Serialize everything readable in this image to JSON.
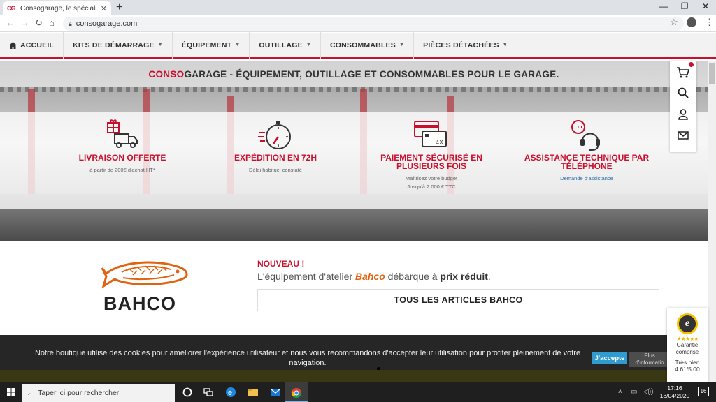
{
  "browser": {
    "tab_title": "Consogarage, le spécialiste franç",
    "tab_favicon": "CG",
    "url": "consogarage.com",
    "icons": [
      "back-icon",
      "forward-icon",
      "reload-icon",
      "home-icon",
      "lock-icon",
      "star-icon",
      "profile-icon",
      "menu-icon"
    ],
    "window_controls": [
      "minimize-icon",
      "restore-icon",
      "close-icon"
    ]
  },
  "nav": {
    "items": [
      {
        "label": "ACCUEIL",
        "icon": "home-icon",
        "caret": false
      },
      {
        "label": "KITS DE DÉMARRAGE",
        "caret": true
      },
      {
        "label": "ÉQUIPEMENT",
        "caret": true
      },
      {
        "label": "OUTILLAGE",
        "caret": true
      },
      {
        "label": "CONSOMMABLES",
        "caret": true
      },
      {
        "label": "PIÈCES DÉTACHÉES",
        "caret": true
      }
    ]
  },
  "hero": {
    "brand_red": "CONSO",
    "tagline": "GARAGE - ÉQUIPEMENT, OUTILLAGE ET CONSOMMABLES POUR LE GARAGE.",
    "features": [
      {
        "title": "LIVRAISON OFFERTE",
        "sub1": "à partir de 200€ d'achat HT*",
        "sub2": "",
        "icon": "delivery-truck-icon"
      },
      {
        "title": "EXPÉDITION EN 72H",
        "sub1": "Délai habituel constaté",
        "sub2": "",
        "icon": "stopwatch-icon"
      },
      {
        "title": "PAIEMENT SÉCURISÉ EN PLUSIEURS FOIS",
        "sub1": "Maîtrisez votre budget",
        "sub2": "Jusqu'à 2 000 € TTC",
        "icon": "credit-card-icon",
        "badge": "4X"
      },
      {
        "title": "ASSISTANCE TECHNIQUE PAR TÉLÉPHONE",
        "sub1": "Demande d'assistance",
        "sub2": "",
        "icon": "headset-icon"
      }
    ]
  },
  "sidebar": {
    "icons": [
      "cart-icon",
      "search-icon",
      "user-icon",
      "mail-icon"
    ]
  },
  "promo": {
    "nouveau": "NOUVEAU !",
    "text_before": "L'équipement d'atelier ",
    "brand": "Bahco",
    "text_middle": " débarque à ",
    "price_text": "prix réduit",
    "text_end": ".",
    "button": "TOUS LES ARTICLES BAHCO",
    "logo_word": "BAHCO"
  },
  "cookie": {
    "text": "Notre boutique utilise des cookies pour améliorer l'expérience utilisateur et nous vous recommandons d'accepter leur utilisation pour profiter pleinement de votre navigation.",
    "accept": "J'accepte",
    "more_line1": "Plus",
    "more_line2": "d'informatio"
  },
  "trust": {
    "seal": "e",
    "stars": "★★★★★",
    "label1": "Garantie",
    "label2": "comprise",
    "rating_label": "Très bien",
    "rating": "4.61/5.00"
  },
  "taskbar": {
    "search_placeholder": "Taper ici pour rechercher",
    "time": "17:16",
    "date": "18/04/2020",
    "notification_count": "16"
  },
  "colors": {
    "brand_red": "#c8102e",
    "bahco_orange": "#e2620f",
    "accept_blue": "#2f9bcf"
  }
}
